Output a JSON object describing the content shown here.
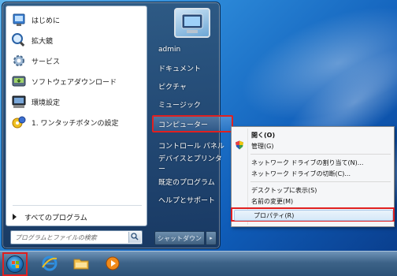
{
  "start_menu": {
    "programs": [
      {
        "label": "はじめに",
        "icon": "getting-started-icon"
      },
      {
        "label": "拡大鏡",
        "icon": "magnifier-icon"
      },
      {
        "label": "サービス",
        "icon": "services-icon"
      },
      {
        "label": "ソフトウェアダウンロード",
        "icon": "software-download-icon"
      },
      {
        "label": "環境設定",
        "icon": "settings-icon"
      },
      {
        "label": "1. ワンタッチボタンの設定",
        "icon": "one-touch-button-icon"
      }
    ],
    "all_programs": "すべてのプログラム",
    "search_placeholder": "プログラムとファイルの検索",
    "right_items": [
      {
        "label": "admin"
      },
      {
        "label": "ドキュメント"
      },
      {
        "label": "ピクチャ"
      },
      {
        "label": "ミュージック"
      },
      {
        "label": "コンピューター",
        "highlighted": true
      },
      {
        "label": "コントロール パネル"
      },
      {
        "label": "デバイスとプリンター"
      },
      {
        "label": "既定のプログラム"
      },
      {
        "label": "ヘルプとサポート"
      }
    ],
    "shutdown": "シャットダウン",
    "shutdown_arrow": "▸"
  },
  "context_menu": {
    "items": [
      {
        "label": "開く(O)",
        "bold": true
      },
      {
        "label": "管理(G)",
        "icon": "shield-icon"
      },
      {
        "label": "ネットワーク ドライブの割り当て(N)..."
      },
      {
        "label": "ネットワーク ドライブの切断(C)..."
      },
      {
        "label": "デスクトップに表示(S)"
      },
      {
        "label": "名前の変更(M)"
      },
      {
        "label": "プロパティ(R)",
        "highlighted": true
      }
    ]
  },
  "taskbar": {
    "items": [
      {
        "name": "start-orb-button",
        "icon": "windows-logo-icon"
      },
      {
        "name": "internet-explorer-button",
        "icon": "internet-explorer-icon"
      },
      {
        "name": "explorer-button",
        "icon": "folder-icon"
      },
      {
        "name": "media-player-button",
        "icon": "media-player-icon"
      }
    ]
  },
  "colors": {
    "highlight_border": "#e02020",
    "menu_background": "#f5f6f8"
  }
}
